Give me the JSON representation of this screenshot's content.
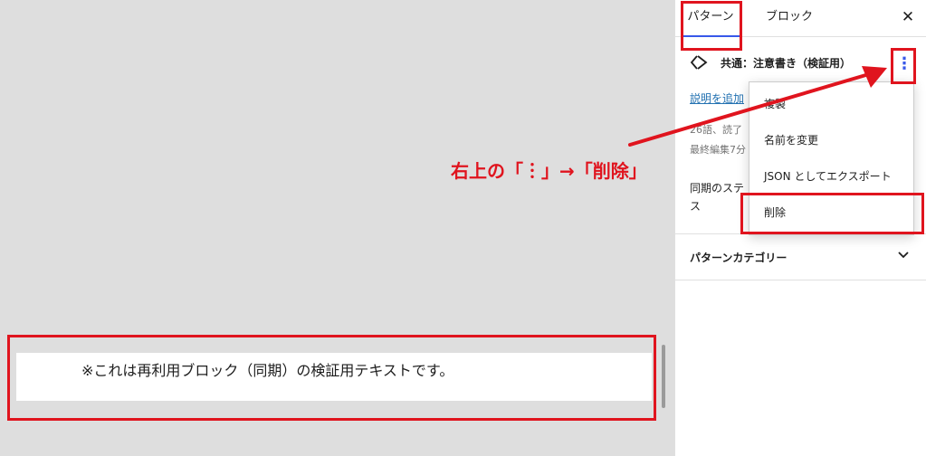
{
  "canvas": {
    "block_text": "※これは再利用ブロック（同期）の検証用テキストです。"
  },
  "sidebar": {
    "tabs": [
      {
        "label": "パターン"
      },
      {
        "label": "ブロック"
      }
    ],
    "close_icon": "✕",
    "pattern_icon": "symbol-icon",
    "pattern_title": "共通：注意書き（検証用）",
    "more_icon": "⋮",
    "add_description": "説明を追加",
    "meta_line1": "26語、読了",
    "meta_line2": "最終編集7分",
    "sync_label_line1": "同期のステ",
    "sync_label_line2": "ス",
    "category_panel_title": "パターンカテゴリー"
  },
  "menu": {
    "items": [
      {
        "label": "複製"
      },
      {
        "label": "名前を変更"
      },
      {
        "label": "JSON としてエクスポート"
      },
      {
        "label": "削除"
      }
    ]
  },
  "annotation": {
    "text": "右上の「︙」→「削除」",
    "color": "#e0141e"
  },
  "colors": {
    "accent": "#3858e9",
    "link": "#2271b1"
  }
}
